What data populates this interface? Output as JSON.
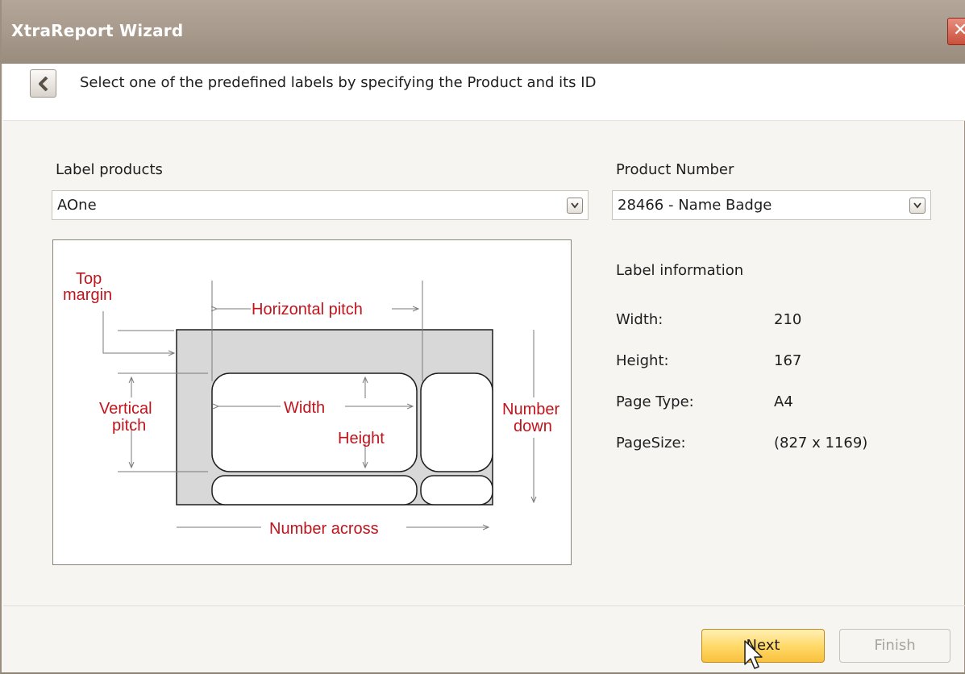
{
  "window": {
    "title": "XtraReport Wizard",
    "close_glyph": "✕"
  },
  "header": {
    "instruction": "Select one of the predefined labels by specifying the Product and its ID"
  },
  "label_products": {
    "label": "Label products",
    "selected": "AOne"
  },
  "product_number": {
    "label": "Product Number",
    "selected": "28466 - Name Badge"
  },
  "diagram": {
    "top_margin_line1": "Top",
    "top_margin_line2": "margin",
    "horizontal_pitch": "Horizontal pitch",
    "vertical_pitch_line1": "Vertical",
    "vertical_pitch_line2": "pitch",
    "width": "Width",
    "height": "Height",
    "number_down_line1": "Number",
    "number_down_line2": "down",
    "number_across": "Number across",
    "text_color": "#c0141c"
  },
  "label_info": {
    "heading": "Label information",
    "rows": [
      {
        "key": "Width:",
        "value": "210"
      },
      {
        "key": "Height:",
        "value": "167"
      },
      {
        "key": "Page Type:",
        "value": "A4"
      },
      {
        "key": "PageSize:",
        "value": "(827 x 1169)"
      }
    ]
  },
  "buttons": {
    "next": "Next",
    "finish": "Finish"
  },
  "icons": {
    "back": "chevron-left-icon",
    "dropdown": "chevron-down-icon",
    "cursor": "mouse-pointer-icon"
  }
}
